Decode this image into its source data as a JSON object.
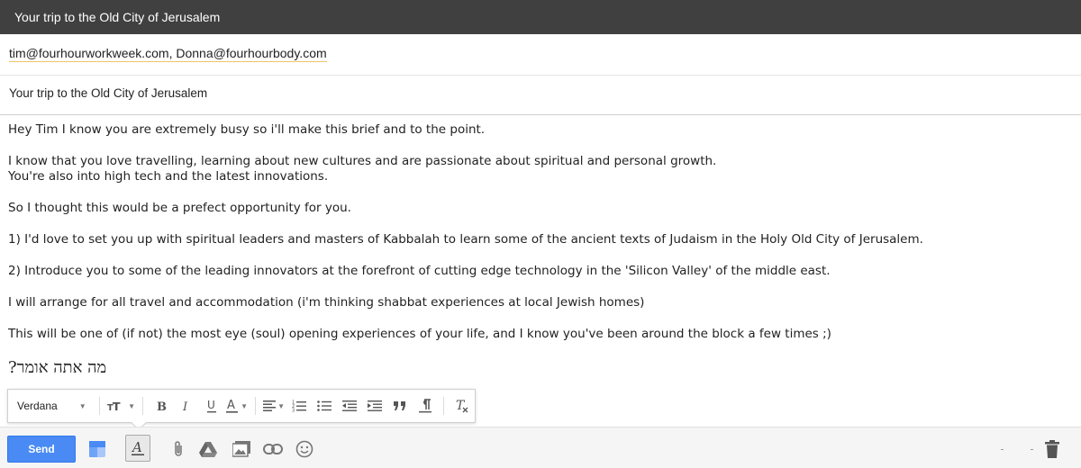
{
  "window": {
    "title": "Your trip to the Old City of Jerusalem"
  },
  "recipients": {
    "list": "tim@fourhourworkweek.com, Donna@fourhourbody.com"
  },
  "subject": {
    "value": "Your trip to the Old City of Jerusalem"
  },
  "body": {
    "p1": "Hey Tim I know you are extremely busy so i'll make this brief and to the point.",
    "p2a": "I know that you love travelling, learning about new cultures and are passionate about spiritual and personal growth.",
    "p2b": "You're also into high tech and the latest innovations.",
    "p3": "So I thought this would be a prefect opportunity for you.",
    "p4": "1) I'd love to set you up with spiritual leaders and masters of Kabbalah to learn some of the ancient texts of Judaism in the Holy Old City of Jerusalem.",
    "p5": "2) Introduce you to some of the leading innovators at the forefront of cutting edge technology in the 'Silicon Valley' of the middle east.",
    "p6": "I will arrange for all travel and accommodation (i'm thinking shabbat experiences at local Jewish homes)",
    "p7": "This will be one of (if not) the most eye (soul) opening experiences of your life, and I know you've been around the block a few times ;)",
    "hebrew": "?מה אתה אומר"
  },
  "format_toolbar": {
    "font": "Verdana",
    "icons": [
      "font-size-icon",
      "bold-icon",
      "italic-icon",
      "underline-icon",
      "text-color-icon",
      "align-icon",
      "numbered-list-icon",
      "bulleted-list-icon",
      "indent-less-icon",
      "indent-more-icon",
      "quote-icon",
      "rtl-icon",
      "remove-formatting-icon"
    ]
  },
  "bottom_bar": {
    "send_label": "Send",
    "icons": [
      "canned-icon",
      "formatting-icon",
      "attach-icon",
      "drive-icon",
      "photo-icon",
      "link-icon",
      "emoji-icon",
      "trash-icon"
    ]
  },
  "colors": {
    "titlebar": "#404040",
    "send": "#4a8af4",
    "chip_underline": "#f0c36d"
  }
}
